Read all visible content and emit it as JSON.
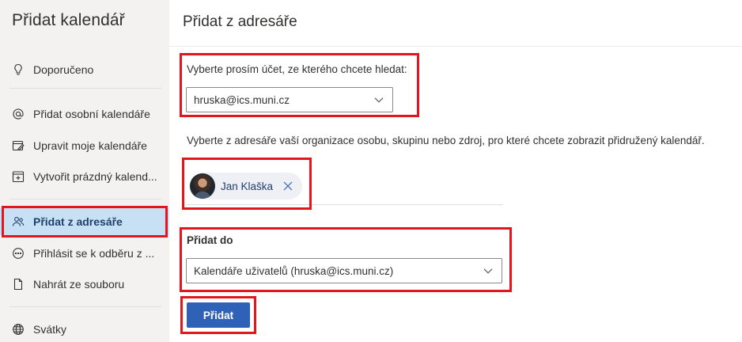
{
  "sidebar": {
    "title": "Přidat kalendář",
    "items": [
      {
        "label": "Doporučeno",
        "icon": "lightbulb-icon"
      },
      {
        "label": "Přidat osobní kalendáře",
        "icon": "at-icon"
      },
      {
        "label": "Upravit moje kalendáře",
        "icon": "edit-calendar-icon"
      },
      {
        "label": "Vytvořit prázdný kalend...",
        "icon": "add-calendar-icon"
      },
      {
        "label": "Přidat z adresáře",
        "icon": "people-icon",
        "active": true
      },
      {
        "label": "Přihlásit se k odběru z ...",
        "icon": "subscribe-icon"
      },
      {
        "label": "Nahrát ze souboru",
        "icon": "file-icon"
      },
      {
        "label": "Svátky",
        "icon": "globe-icon"
      }
    ]
  },
  "main": {
    "title": "Přidat z adresáře",
    "account_label": "Vyberte prosím účet, ze kterého chcete hledat:",
    "account_value": "hruska@ics.muni.cz",
    "directory_label": "Vyberte z adresáře vaší organizace osobu, skupinu nebo zdroj, pro které chcete zobrazit přidružený kalendář.",
    "person_name": "Jan Klaška",
    "add_to_label": "Přidat do",
    "add_to_value": "Kalendáře uživatelů (hruska@ics.muni.cz)",
    "add_button": "Přidat"
  },
  "colors": {
    "accent": "#2f62b6",
    "active_item_bg": "#c7e0f4",
    "highlight": "#e3161d",
    "sidebar_bg": "#f3f2f1"
  }
}
